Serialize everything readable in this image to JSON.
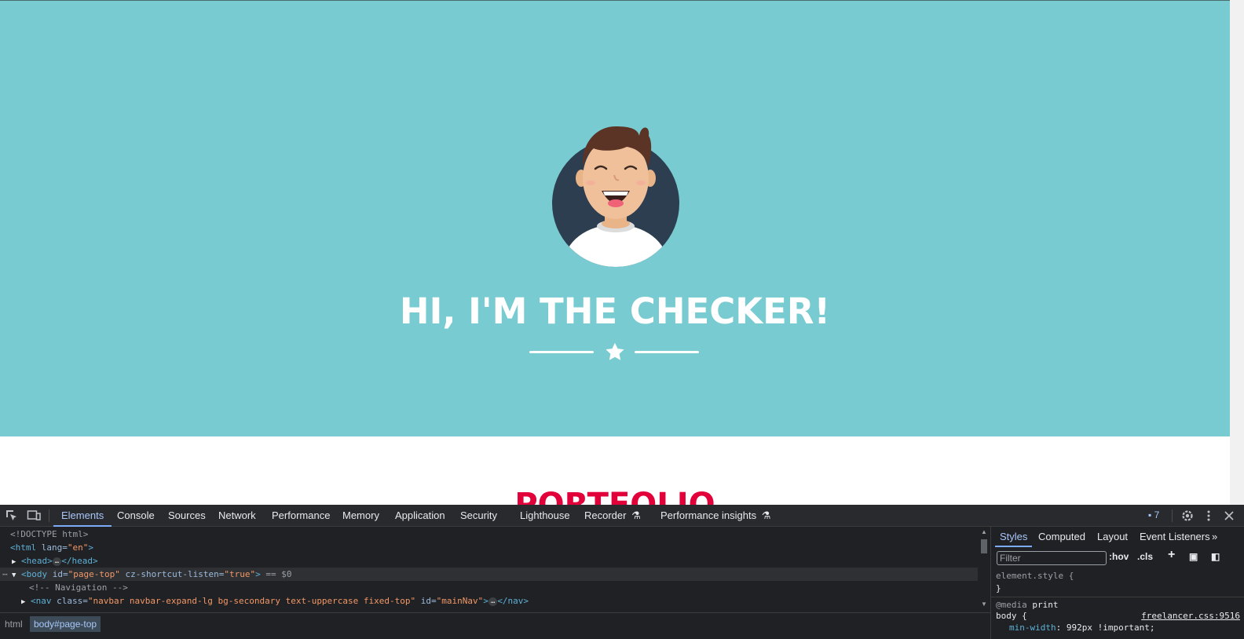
{
  "page": {
    "hero_title": "HI, I'M THE CHECKER!",
    "portfolio_heading": "PORTFOLIO",
    "colors": {
      "masthead": "#78cbd1",
      "heading_accent": "#e2003a",
      "hero_text": "#ffffff"
    }
  },
  "devtools": {
    "tabs": [
      "Elements",
      "Console",
      "Sources",
      "Network",
      "Performance",
      "Memory",
      "Application",
      "Security",
      "Lighthouse",
      "Recorder",
      "Performance insights"
    ],
    "active_tab": "Elements",
    "issues_count": "7",
    "dom": {
      "doctype": "<!DOCTYPE html>",
      "html_tag": "html",
      "html_attr_name": "lang",
      "html_attr_value": "\"en\"",
      "head_open": "<head>",
      "head_close": "</head>",
      "body_tag": "body",
      "body_attr1_name": "id",
      "body_attr1_value": "\"page-top\"",
      "body_attr2_name": "cz-shortcut-listen",
      "body_attr2_value": "\"true\"",
      "body_marker": "== $0",
      "comment": "<!-- Navigation -->",
      "nav_tag": "nav",
      "nav_attr1_name": "class",
      "nav_attr1_value": "\"navbar navbar-expand-lg bg-secondary text-uppercase fixed-top\"",
      "nav_attr2_name": "id",
      "nav_attr2_value": "\"mainNav\"",
      "nav_close": "</nav>",
      "ellipsis": "…"
    },
    "breadcrumbs": [
      "html",
      "body#page-top"
    ],
    "styles_pane": {
      "tabs": [
        "Styles",
        "Computed",
        "Layout",
        "Event Listeners"
      ],
      "active_tab": "Styles",
      "filter_placeholder": "Filter",
      "hov": ":hov",
      "cls": ".cls",
      "element_style": "element.style {",
      "close_brace": "}",
      "media_keyword": "@media",
      "media_value": "print",
      "body_selector": "body {",
      "source_link": "freelancer.css:9516",
      "prop_name": "min-width",
      "prop_value": "992px !important;"
    }
  }
}
